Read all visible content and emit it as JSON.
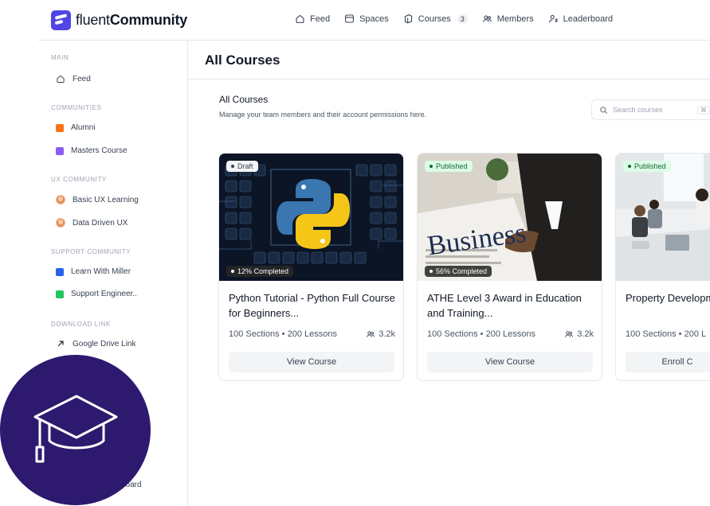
{
  "brand": {
    "name_light": "fluent",
    "name_bold": "Community"
  },
  "topnav": [
    {
      "label": "Feed",
      "icon": "home-icon"
    },
    {
      "label": "Spaces",
      "icon": "spaces-icon"
    },
    {
      "label": "Courses",
      "icon": "courses-icon",
      "count": "3"
    },
    {
      "label": "Members",
      "icon": "members-icon"
    },
    {
      "label": "Leaderboard",
      "icon": "leaderboard-icon"
    }
  ],
  "sidebar": {
    "sections": [
      {
        "title": "MAIN"
      },
      {
        "title": "COMMUNITIES"
      },
      {
        "title": "UX COMMUNITY"
      },
      {
        "title": "SUPPORT COMMUNITY"
      },
      {
        "title": "DOWNLOAD LINK"
      }
    ],
    "items": [
      {
        "label": "Feed",
        "icon": "home-icon"
      },
      {
        "label": "Alumni",
        "color": "#f97316"
      },
      {
        "label": "Masters Course",
        "color": "#8b5cf6"
      },
      {
        "label": "Basic UX Learning",
        "icon": "avatar"
      },
      {
        "label": "Data Driven UX",
        "icon": "avatar"
      },
      {
        "label": "Learn With Miller",
        "color": "#2563eb"
      },
      {
        "label": "Support Engineer..",
        "color": "#22c55e"
      },
      {
        "label": "Google Drive Link",
        "icon": "arrow-up-right-icon"
      }
    ],
    "peek_label": "board"
  },
  "main": {
    "page_title": "All Courses",
    "section_title": "All Courses",
    "section_subtitle": "Manage your team members and their account permissions here.",
    "search": {
      "placeholder": "Search courses",
      "shortcut": "⌘"
    }
  },
  "courses": [
    {
      "status": "Draft",
      "progress": "12% Completed",
      "title": "Python Tutorial - Python Full Course for Beginners...",
      "sections": "100 Sections",
      "lessons": "200 Lessons",
      "members": "3.2k",
      "button": "View Course"
    },
    {
      "status": "Published",
      "progress": "56% Completed",
      "title": "ATHE Level 3 Award in Education and Training...",
      "sections": "100 Sections",
      "lessons": "200 Lessons",
      "members": "3.2k",
      "button": "View Course",
      "image_text": "Business"
    },
    {
      "status": "Published",
      "title": "Property Developm",
      "sections": "100 Sections",
      "lessons": "200 L",
      "button": "Enroll C"
    }
  ],
  "colors": {
    "brand": "#4f46e5",
    "badge_bg": "#2d1a6f",
    "published": "#dcfce7"
  }
}
